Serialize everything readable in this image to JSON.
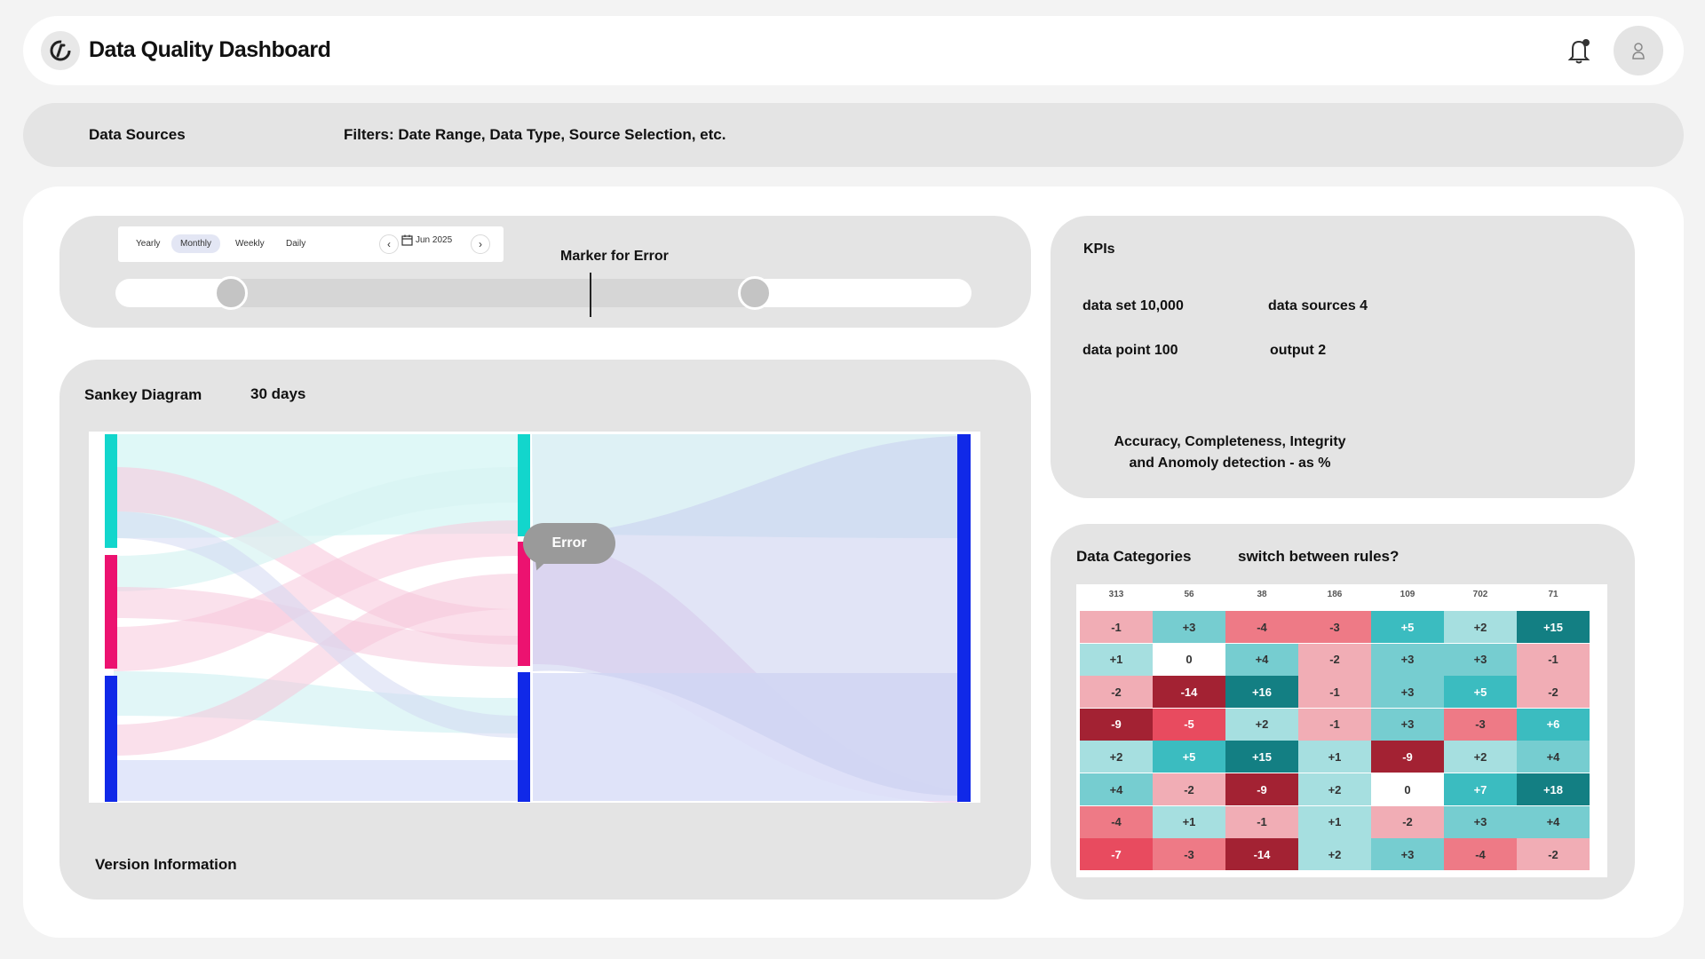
{
  "header": {
    "title": "Data Quality Dashboard",
    "logo_icon": "brand-logo-icon",
    "notification_icon": "bell-icon",
    "avatar_icon": "user-icon"
  },
  "filter_bar": {
    "sources_label": "Data Sources",
    "filters_label": "Filters: Date Range, Data Type, Source Selection, etc."
  },
  "timeline": {
    "periods": [
      "Yearly",
      "Monthly",
      "Weekly",
      "Daily"
    ],
    "active_period": "Monthly",
    "current_month": "Jun 2025",
    "marker_label": "Marker for Error",
    "range_start_fraction": 0.14,
    "range_end_fraction": 0.75,
    "error_marker_fraction": 0.52
  },
  "sankey": {
    "title": "Sankey Diagram",
    "period": "30 days",
    "tooltip": "Error",
    "footer": "Version Information",
    "colors": {
      "cyan": "#12d6cc",
      "pink": "#ec1270",
      "blue": "#1029e8"
    }
  },
  "kpis": {
    "title": "KPIs",
    "items": [
      {
        "label": "data set 10,000"
      },
      {
        "label": "data sources 4"
      },
      {
        "label": "data point 100"
      },
      {
        "label": "output 2"
      }
    ],
    "note_line1": "Accuracy, Completeness, Integrity",
    "note_line2": "and Anomoly detection - as %"
  },
  "categories": {
    "title": "Data Categories",
    "subtitle": "switch between rules?",
    "columns": [
      "313",
      "56",
      "38",
      "186",
      "109",
      "702",
      "71"
    ],
    "rows": [
      [
        "-1",
        "+3",
        "-4",
        "-3",
        "+5",
        "+2",
        "+15"
      ],
      [
        "+1",
        "0",
        "+4",
        "-2",
        "+3",
        "+3",
        "-1"
      ],
      [
        "-2",
        "-14",
        "+16",
        "-1",
        "+3",
        "+5",
        "-2"
      ],
      [
        "-9",
        "-5",
        "+2",
        "-1",
        "+3",
        "-3",
        "+6"
      ],
      [
        "+2",
        "+5",
        "+15",
        "+1",
        "-9",
        "+2",
        "+4"
      ],
      [
        "+4",
        "-2",
        "-9",
        "+2",
        "0",
        "+7",
        "+18"
      ],
      [
        "-4",
        "+1",
        "-1",
        "+1",
        "-2",
        "+3",
        "+4"
      ],
      [
        "-7",
        "-3",
        "-14",
        "+2",
        "+3",
        "-4",
        "-2"
      ]
    ]
  }
}
